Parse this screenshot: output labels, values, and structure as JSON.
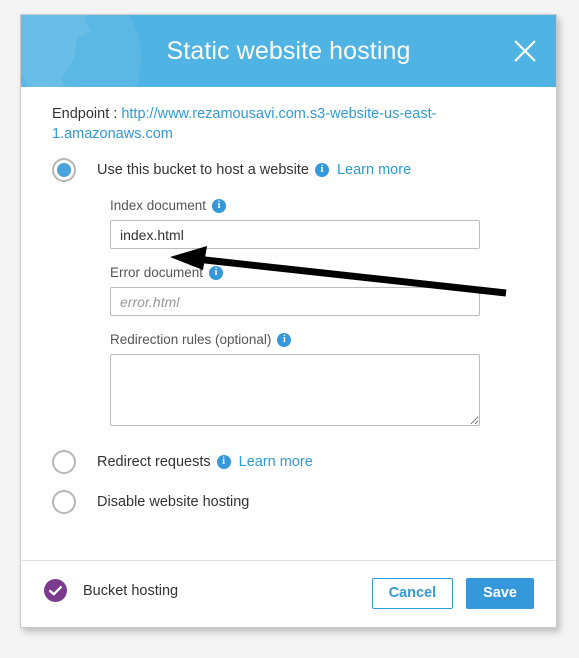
{
  "window": {
    "title": "Static website hosting",
    "close_icon": "close-icon"
  },
  "colors": {
    "header_blue": "#4fb3e3",
    "accent_blue": "#3498db",
    "link_blue": "#2f9bd9",
    "badge_purple": "#7a3b8e",
    "page_background": "#f4f4f4"
  },
  "endpoint": {
    "label": "Endpoint :",
    "url": "http://www.rezamousavi.com.s3-website-us-east-1.amazonaws.com"
  },
  "options": [
    {
      "id": "use-bucket",
      "label": "Use this bucket to host a website",
      "selected": true,
      "info_icon": "info-icon",
      "learn_more": "Learn more"
    },
    {
      "id": "redirect-requests",
      "label": "Redirect requests",
      "selected": false,
      "info_icon": "info-icon",
      "learn_more": "Learn more"
    },
    {
      "id": "disable-hosting",
      "label": "Disable website hosting",
      "selected": false
    }
  ],
  "fields": {
    "index_document": {
      "label": "Index document",
      "value": "index.html",
      "placeholder": "index.html"
    },
    "error_document": {
      "label": "Error document",
      "value": "",
      "placeholder": "error.html"
    },
    "redirection_rules": {
      "label": "Redirection rules (optional)",
      "value": "",
      "placeholder": ""
    }
  },
  "footer": {
    "badge_label": "Bucket hosting",
    "badge_icon": "check-circle-icon",
    "cancel_label": "Cancel",
    "save_label": "Save"
  },
  "annotation": {
    "type": "arrow",
    "points_to": "index-document-input"
  }
}
